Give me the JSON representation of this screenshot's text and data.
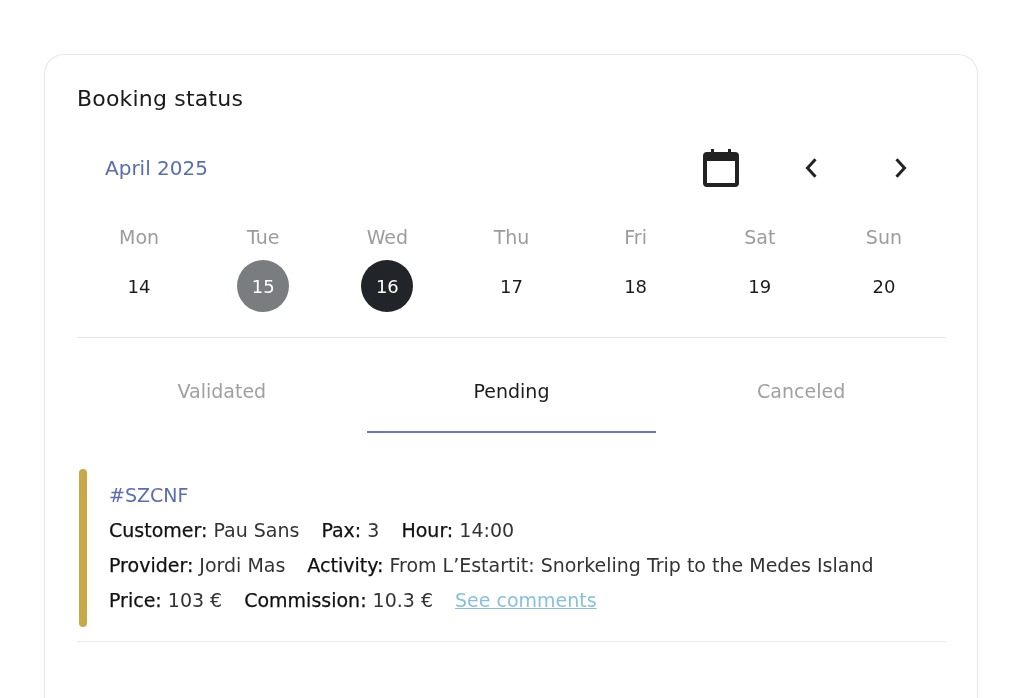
{
  "card": {
    "title": "Booking status"
  },
  "calendar": {
    "month": "April 2025",
    "weekdays": [
      "Mon",
      "Tue",
      "Wed",
      "Thu",
      "Fri",
      "Sat",
      "Sun"
    ],
    "days": [
      {
        "label": "14",
        "selected": false,
        "today": false
      },
      {
        "label": "15",
        "selected": false,
        "today": true
      },
      {
        "label": "16",
        "selected": true,
        "today": false
      },
      {
        "label": "17",
        "selected": false,
        "today": false
      },
      {
        "label": "18",
        "selected": false,
        "today": false
      },
      {
        "label": "19",
        "selected": false,
        "today": false
      },
      {
        "label": "20",
        "selected": false,
        "today": false
      }
    ]
  },
  "tabs": [
    {
      "label": "Validated",
      "selected": false
    },
    {
      "label": "Pending",
      "selected": true
    },
    {
      "label": "Canceled",
      "selected": false
    }
  ],
  "bookings": [
    {
      "code": "#SZCNF",
      "color": "#c9a84a",
      "lines": [
        [
          {
            "label": "Customer:",
            "value": "Pau Sans"
          },
          {
            "label": "Pax:",
            "value": "3"
          },
          {
            "label": "Hour:",
            "value": "14:00"
          }
        ],
        [
          {
            "label": "Provider:",
            "value": "Jordi Mas"
          },
          {
            "label": "Activity:",
            "value": "From L’Estartit: Snorkeling Trip to the Medes Island"
          }
        ],
        [
          {
            "label": "Price:",
            "value": "103 €"
          },
          {
            "label": "Commission:",
            "value": "10.3 €"
          }
        ]
      ],
      "link": "See comments"
    }
  ]
}
